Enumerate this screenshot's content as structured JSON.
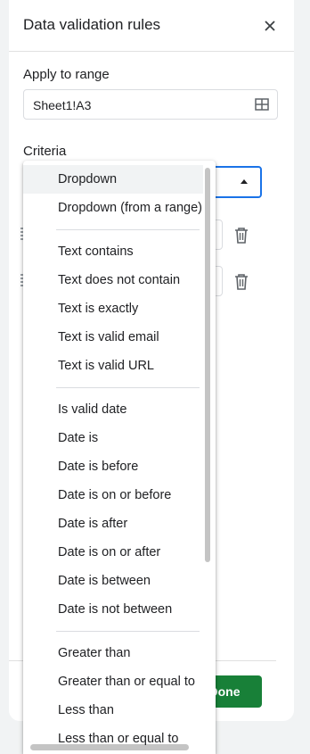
{
  "dialog": {
    "title": "Data validation rules",
    "close_icon": "close-icon",
    "apply_to_range_label": "Apply to range",
    "range_value": "Sheet1!A3",
    "range_icon": "grid-icon",
    "criteria_label": "Criteria",
    "done_label": "Done",
    "accent_color": "#1a73e8",
    "done_color": "#188038"
  },
  "menu": {
    "selected": "Dropdown",
    "groups": [
      {
        "items": [
          "Dropdown",
          "Dropdown (from a range)"
        ]
      },
      {
        "items": [
          "Text contains",
          "Text does not contain",
          "Text is exactly",
          "Text is valid email",
          "Text is valid URL"
        ]
      },
      {
        "items": [
          "Is valid date",
          "Date is",
          "Date is before",
          "Date is on or before",
          "Date is after",
          "Date is on or after",
          "Date is between",
          "Date is not between"
        ]
      },
      {
        "items": [
          "Greater than",
          "Greater than or equal to",
          "Less than",
          "Less than or equal to"
        ]
      }
    ]
  }
}
